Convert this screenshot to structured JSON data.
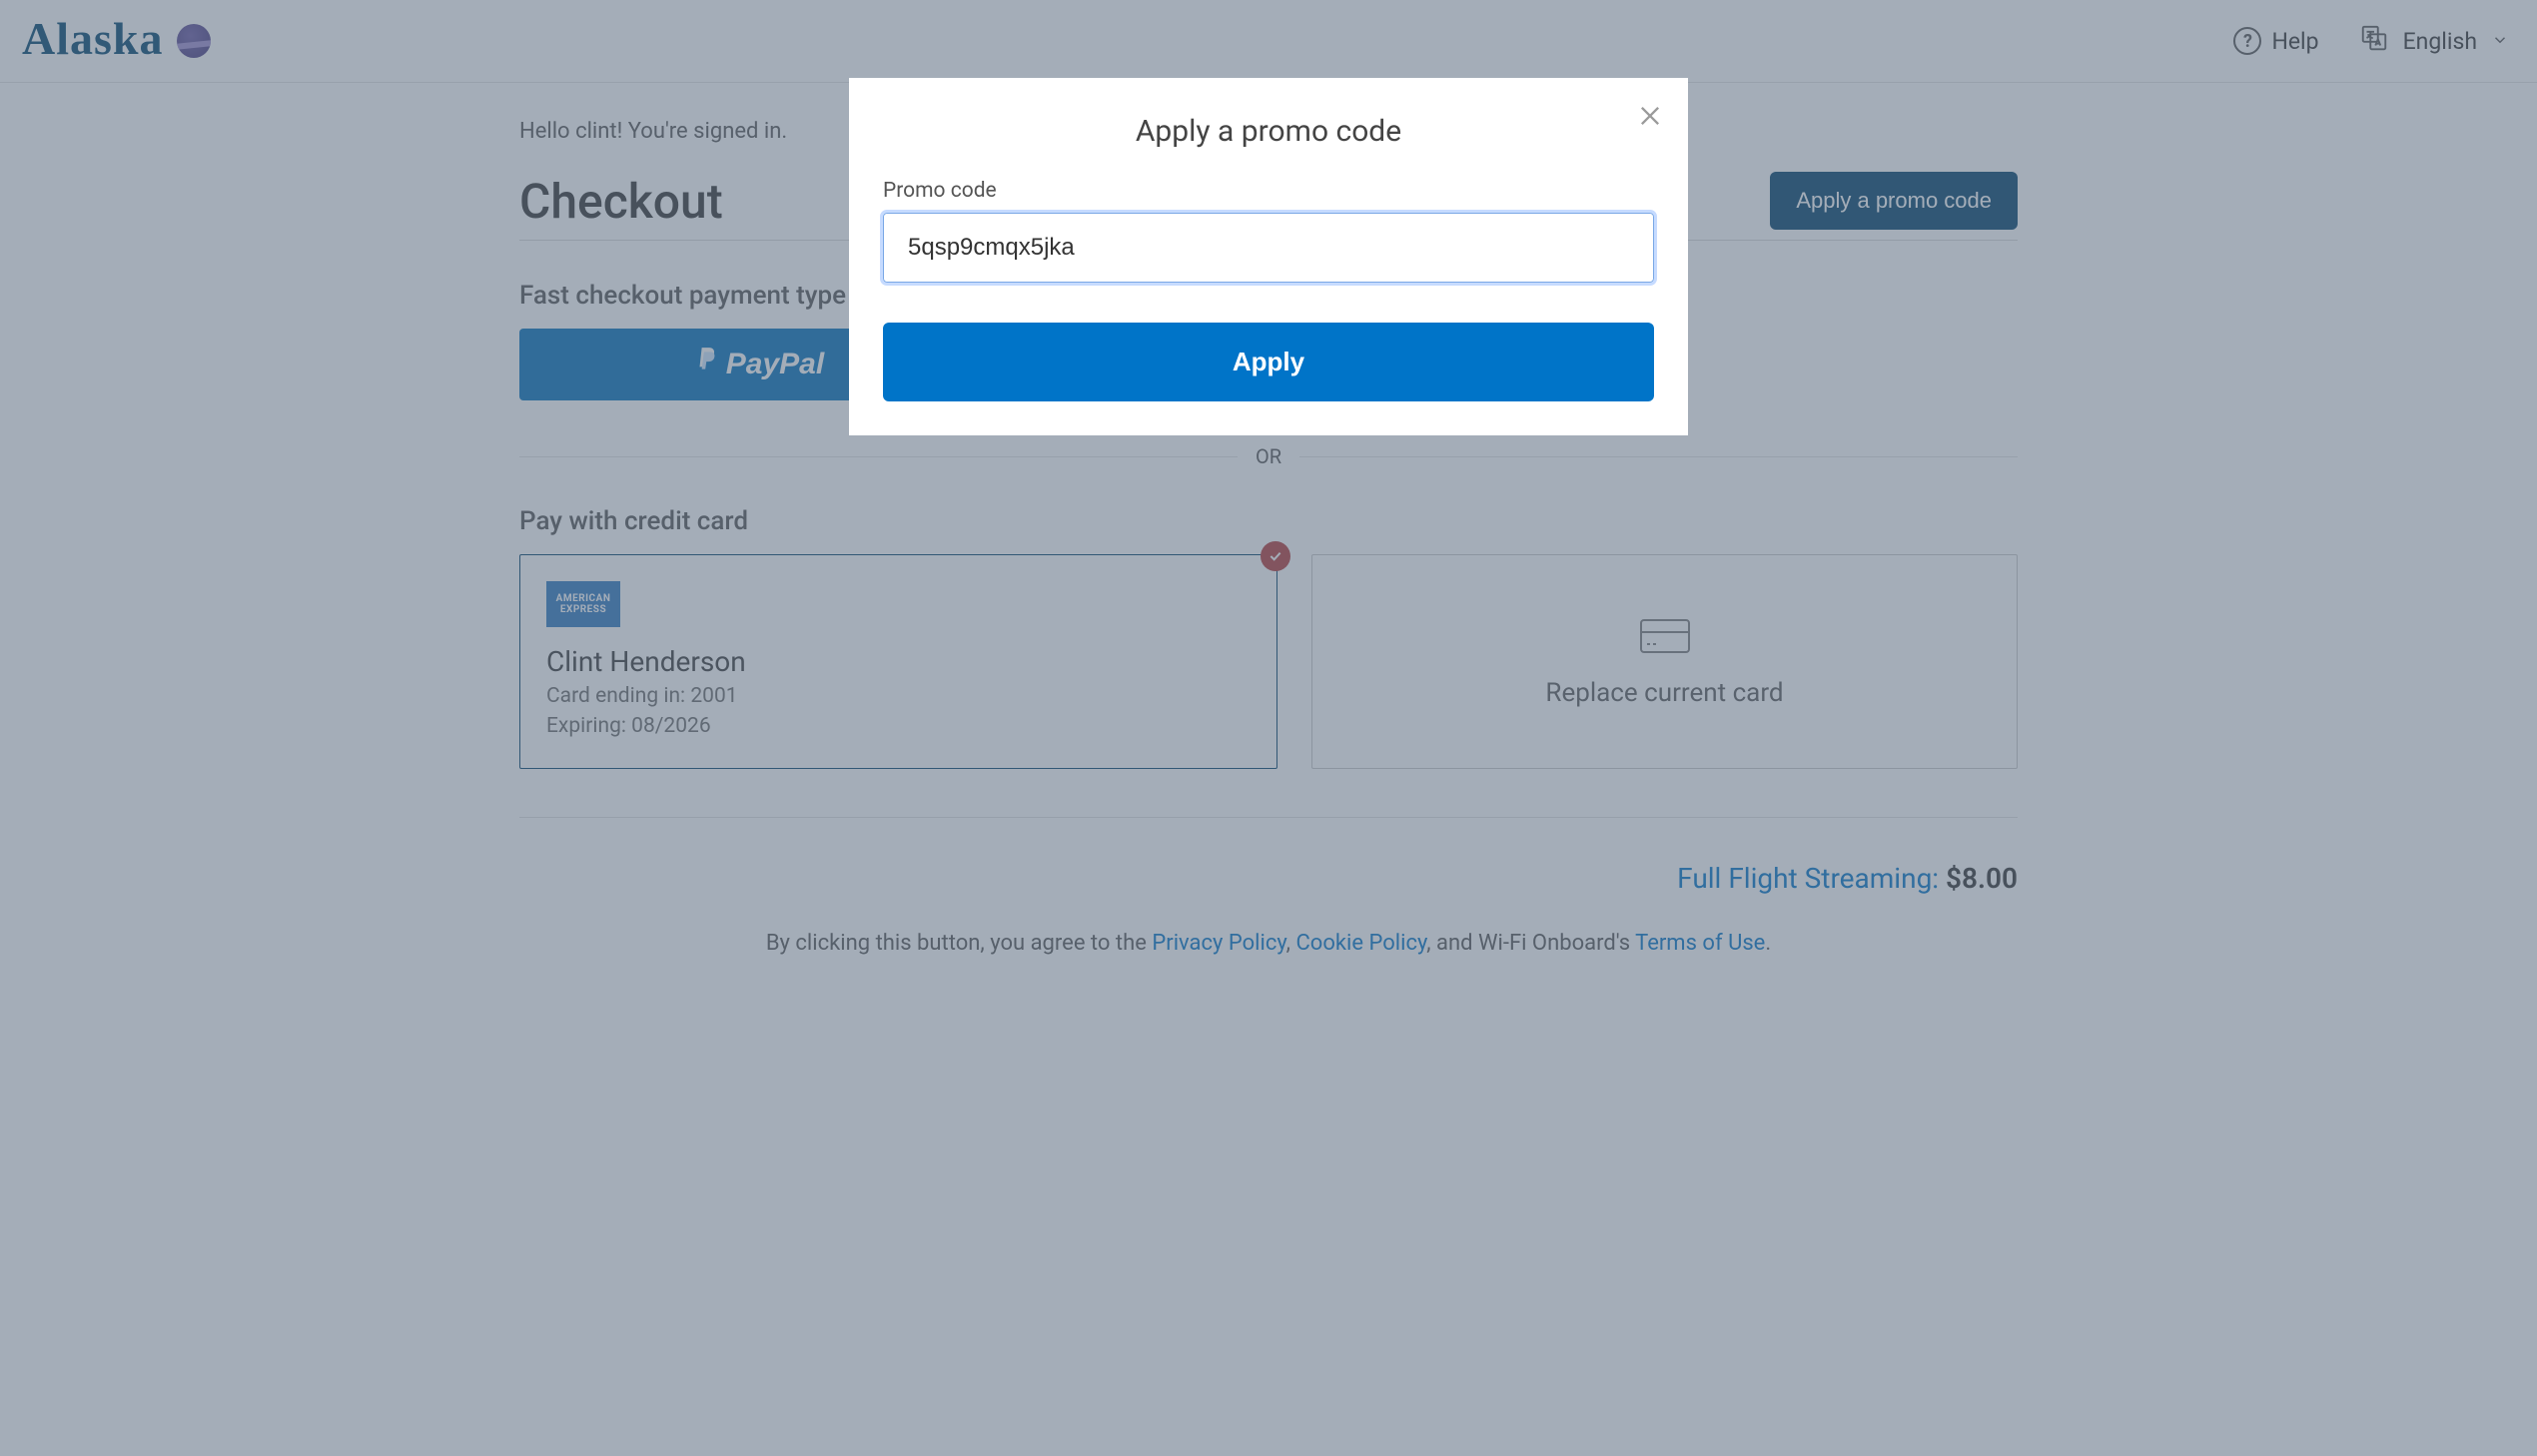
{
  "header": {
    "brand_text": "Alaska",
    "help_label": "Help",
    "language_label": "English"
  },
  "greeting": "Hello clint! You're signed in.",
  "checkout": {
    "title": "Checkout",
    "promo_button": "Apply a promo code"
  },
  "fast_checkout": {
    "label": "Fast checkout payment type",
    "paypal_label": "PayPal"
  },
  "divider_or": "OR",
  "credit_card": {
    "section_label": "Pay with credit card",
    "brand": "AMERICAN EXPRESS",
    "holder_name": "Clint Henderson",
    "ending_line": "Card ending in: 2001",
    "expiring_line": "Expiring: 08/2026",
    "replace_label": "Replace current card"
  },
  "streaming": {
    "link_text": "Full Flight Streaming:",
    "price": "$8.00"
  },
  "legal": {
    "prefix": "By clicking this button, you agree to the ",
    "privacy": "Privacy Policy",
    "comma1": ", ",
    "cookie": "Cookie Policy",
    "mid": ", and Wi-Fi Onboard's ",
    "terms": "Terms of Use",
    "suffix": "."
  },
  "modal": {
    "title": "Apply a promo code",
    "field_label": "Promo code",
    "input_value": "5qsp9cmqx5jka",
    "apply_label": "Apply"
  }
}
